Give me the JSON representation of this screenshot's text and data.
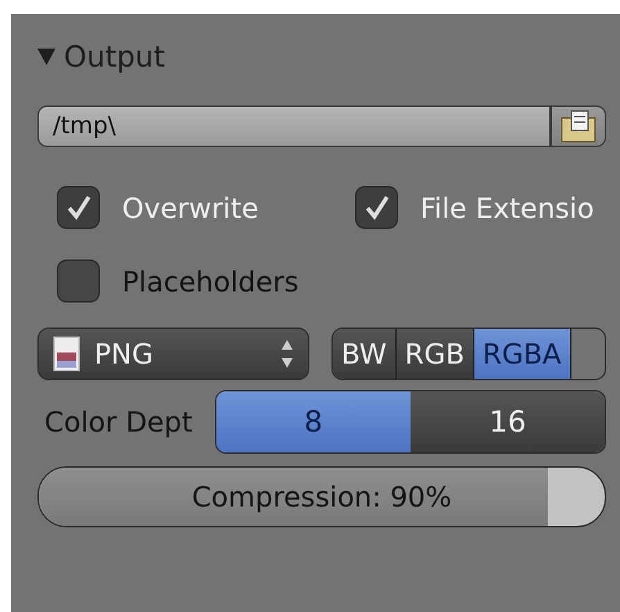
{
  "panel": {
    "title": "Output",
    "expanded": true,
    "path_field": {
      "value": "/tmp\\"
    },
    "checkboxes": [
      {
        "label": "Overwrite",
        "checked": true
      },
      {
        "label": "File Extensio",
        "checked": true
      },
      {
        "label": "Placeholders",
        "checked": false
      }
    ],
    "format_select": {
      "value": "PNG"
    },
    "color_modes": [
      {
        "label": "BW",
        "selected": false
      },
      {
        "label": "RGB",
        "selected": false
      },
      {
        "label": "RGBA",
        "selected": true
      }
    ],
    "color_depth": {
      "label": "Color Dept",
      "options": [
        {
          "label": "8",
          "selected": true
        },
        {
          "label": "16",
          "selected": false
        }
      ]
    },
    "compression": {
      "label": "Compression: 90%",
      "level": 0.9
    }
  }
}
